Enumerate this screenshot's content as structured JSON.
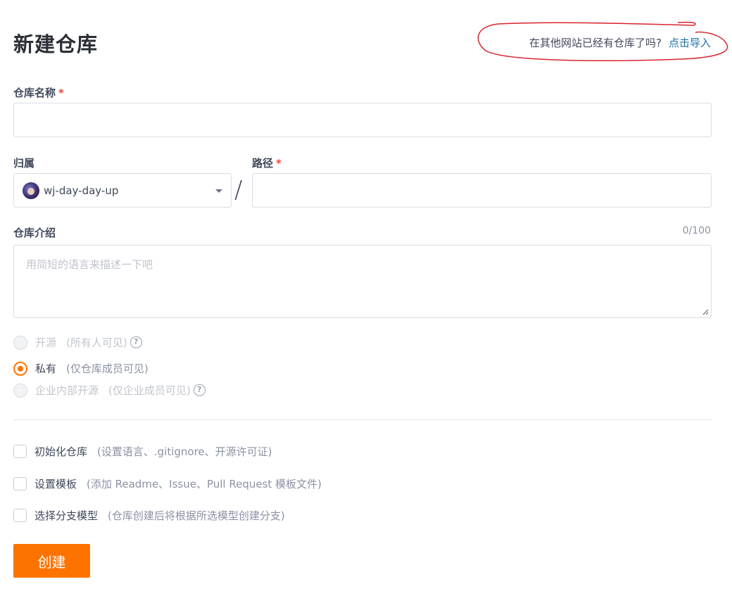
{
  "page_title": "新建仓库",
  "import_hint": {
    "text": "在其他网站已经有仓库了吗?",
    "link": "点击导入"
  },
  "repo_name": {
    "label": "仓库名称",
    "required_mark": "*",
    "value": ""
  },
  "owner": {
    "label": "归属",
    "value": "wj-day-day-up",
    "separator": "/"
  },
  "path": {
    "label": "路径",
    "required_mark": "*",
    "value": ""
  },
  "description": {
    "label": "仓库介绍",
    "counter": "0/100",
    "placeholder": "用简短的语言来描述一下吧"
  },
  "visibility": [
    {
      "label": "开源",
      "note": "(所有人可见)",
      "state": "disabled",
      "has_help": true
    },
    {
      "label": "私有",
      "note": "(仅仓库成员可见)",
      "state": "checked",
      "has_help": false
    },
    {
      "label": "企业内部开源",
      "note": "(仅企业成员可见)",
      "state": "disabled",
      "has_help": true
    }
  ],
  "help_glyph": "?",
  "options": [
    {
      "label": "初始化仓库",
      "note": "(设置语言、.gitignore、开源许可证)"
    },
    {
      "label": "设置模板",
      "note": "(添加 Readme、Issue、Pull Request 模板文件)"
    },
    {
      "label": "选择分支模型",
      "note": "(仓库创建后将根据所选模型创建分支)"
    }
  ],
  "submit_label": "创建",
  "colors": {
    "accent": "#fe7300",
    "link": "#1a73a8",
    "required": "#e64a3b",
    "annotation": "#d9232e"
  }
}
